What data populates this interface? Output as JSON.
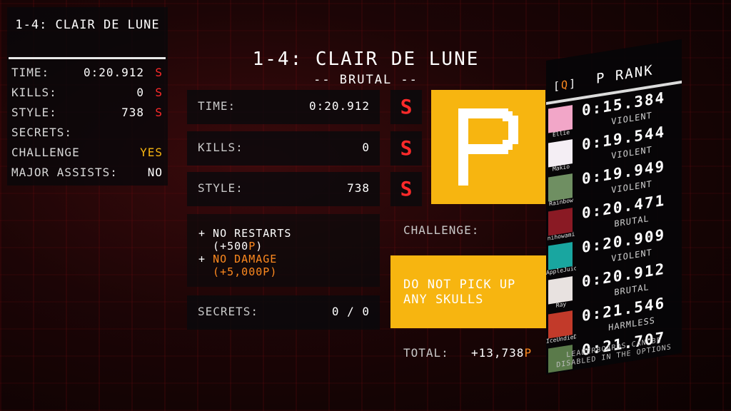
{
  "summary": {
    "title": "1-4: CLAIR DE LUNE",
    "rows": [
      {
        "label": "TIME:",
        "value": "0:20.912",
        "rank": "S"
      },
      {
        "label": "KILLS:",
        "value": "0",
        "rank": "S"
      },
      {
        "label": "STYLE:",
        "value": "738",
        "rank": "S"
      },
      {
        "label": "SECRETS:",
        "value": "",
        "rank": ""
      },
      {
        "label": "CHALLENGE",
        "value": "YES",
        "rank": ""
      },
      {
        "label": "MAJOR ASSISTS:",
        "value": "NO",
        "rank": ""
      }
    ]
  },
  "level": {
    "title": "1-4: CLAIR DE LUNE",
    "difficulty": "-- BRUTAL --"
  },
  "stats": {
    "time_label": "TIME:",
    "time_value": "0:20.912",
    "time_rank": "S",
    "kills_label": "KILLS:",
    "kills_value": "0",
    "kills_rank": "S",
    "style_label": "STYLE:",
    "style_value": "738",
    "style_rank": "S",
    "secrets_label": "SECRETS:",
    "secrets_value": "0 / 0"
  },
  "bonuses": {
    "line1": "+ NO RESTARTS",
    "line2_prefix": "  (+500",
    "line2_p": "P",
    "line2_suffix": ")",
    "line3_prefix": "+ ",
    "line3_orange": "NO DAMAGE",
    "line4_prefix": "  (+5,000",
    "line4_p": "P",
    "line4_suffix": ")"
  },
  "final_rank": "P",
  "challenge": {
    "label": "CHALLENGE:",
    "line1": "DO NOT PICK UP",
    "line2": "ANY SKULLS"
  },
  "total": {
    "label": "TOTAL:",
    "value": "+13,738",
    "suffix": "P"
  },
  "leaderboard": {
    "key_open": "[",
    "key": "Q",
    "key_close": "]",
    "title": "P RANK",
    "entries": [
      {
        "name": "Ellie",
        "time": "0:15.384",
        "difficulty": "VIOLENT",
        "avatar_color": "#f2a6c8"
      },
      {
        "name": "Makio",
        "time": "0:19.544",
        "difficulty": "VIOLENT",
        "avatar_color": "#f4eef4"
      },
      {
        "name": "Rainbow",
        "time": "0:19.949",
        "difficulty": "VIOLENT",
        "avatar_color": "#6f8f62"
      },
      {
        "name": "nihowami",
        "time": "0:20.471",
        "difficulty": "BRUTAL",
        "avatar_color": "#8a1a24"
      },
      {
        "name": "AppleJuice",
        "time": "0:20.909",
        "difficulty": "VIOLENT",
        "avatar_color": "#19a6a0"
      },
      {
        "name": "Ray",
        "time": "0:20.912",
        "difficulty": "BRUTAL",
        "avatar_color": "#e8e2e0"
      },
      {
        "name": "IceUndieDeath",
        "time": "0:21.546",
        "difficulty": "HARMLESS",
        "avatar_color": "#c23a2a"
      },
      {
        "name": "",
        "time": "0:21.707",
        "difficulty": "",
        "avatar_color": "#5a7a4a"
      }
    ],
    "note_line1": "LEADERBOARDS CAN BE",
    "note_line2": "DISABLED IN THE OPTIONS"
  },
  "colors": {
    "rank_red": "#ff2a2a",
    "accent_orange": "#ff8a1f",
    "gold": "#f7b510"
  }
}
